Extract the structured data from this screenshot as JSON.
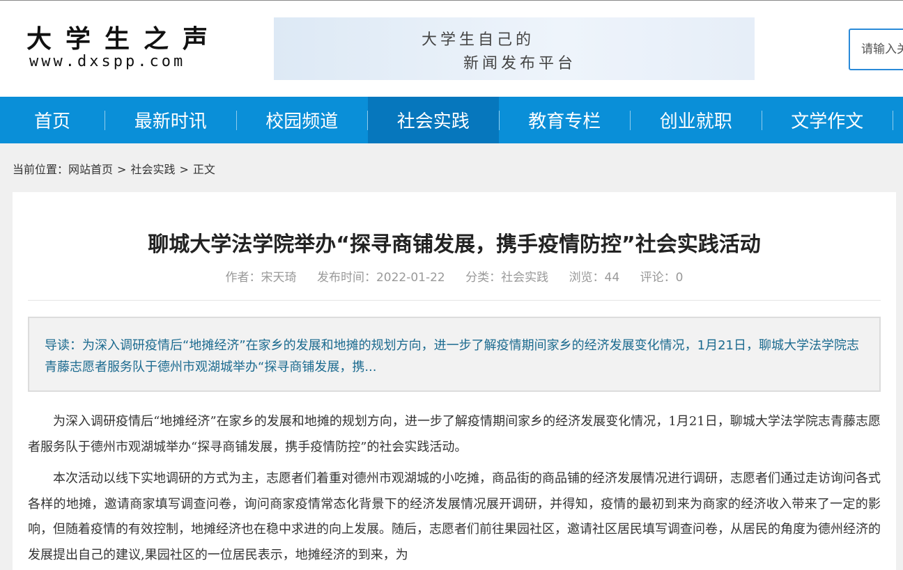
{
  "header": {
    "logo_main": "大学生之声",
    "logo_sub": "www.dxspp.com",
    "banner_line1": "大学生自己的",
    "banner_line2": "新闻发布平台",
    "search_placeholder": "请输入关键词"
  },
  "nav": {
    "items": [
      {
        "label": "首页"
      },
      {
        "label": "最新时讯"
      },
      {
        "label": "校园频道"
      },
      {
        "label": "社会实践"
      },
      {
        "label": "教育专栏"
      },
      {
        "label": "创业就职"
      },
      {
        "label": "文学作文"
      }
    ],
    "active_index": 3
  },
  "breadcrumb": {
    "prefix": "当前位置：",
    "home": "网站首页",
    "separator": ">",
    "category": "社会实践",
    "current": "正文"
  },
  "article": {
    "title": "聊城大学法学院举办“探寻商铺发展，携手疫情防控”社会实践活动",
    "meta": {
      "author": "作者：宋天琦",
      "date": "发布时间：2022-01-22",
      "category": "分类：社会实践",
      "views": "浏览：44",
      "comments": "评论：0"
    },
    "summary": "导读：为深入调研疫情后“地摊经济”在家乡的发展和地摊的规划方向，进一步了解疫情期间家乡的经济发展变化情况，1月21日，聊城大学法学院志青藤志愿者服务队于德州市观湖城举办“探寻商铺发展，携...",
    "paragraphs": [
      "为深入调研疫情后“地摊经济”在家乡的发展和地摊的规划方向，进一步了解疫情期间家乡的经济发展变化情况，1月21日，聊城大学法学院志青藤志愿者服务队于德州市观湖城举办“探寻商铺发展，携手疫情防控”的社会实践活动。",
      "本次活动以线下实地调研的方式为主，志愿者们着重对德州市观湖城的小吃摊，商品街的商品铺的经济发展情况进行调研，志愿者们通过走访询问各式各样的地摊，邀请商家填写调查问卷，询问商家疫情常态化背景下的经济发展情况展开调研，并得知，疫情的最初到来为商家的经济收入带来了一定的影响，但随着疫情的有效控制，地摊经济也在稳中求进的向上发展。随后，志愿者们前往果园社区，邀请社区居民填写调查问卷，从居民的角度为德州经济的发展提出自己的建议,果园社区的一位居民表示，地摊经济的到来，为"
    ]
  },
  "colors": {
    "nav_bg": "#0a8fd8",
    "nav_active": "#0677bd",
    "summary_text": "#1b6a8f",
    "search_border": "#2a8ad8"
  }
}
